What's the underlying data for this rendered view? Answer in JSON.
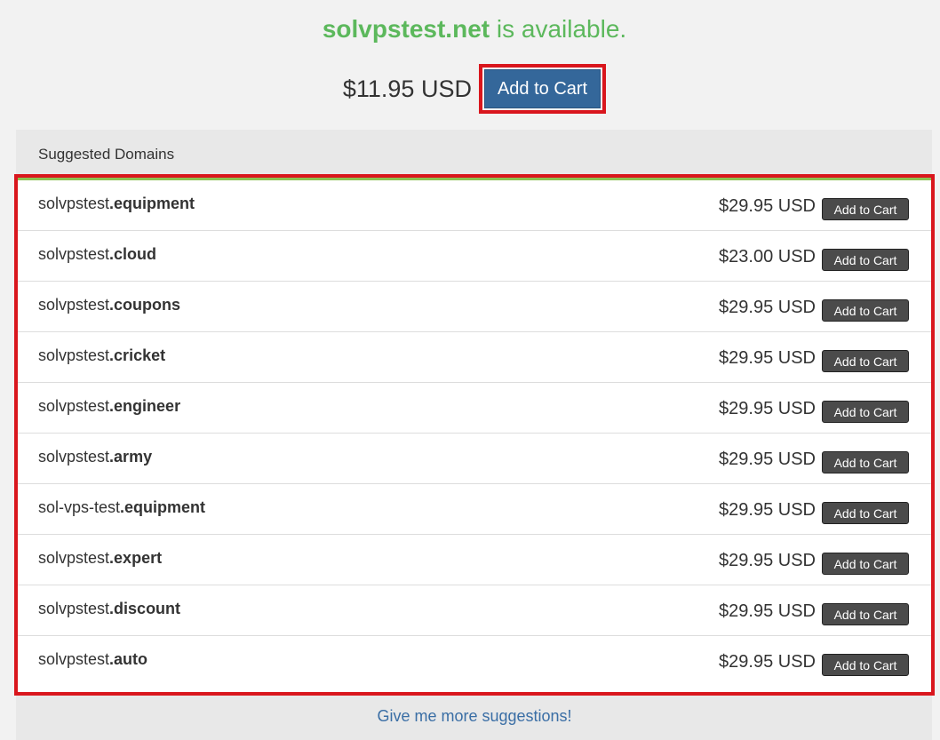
{
  "availability": {
    "domain": "solvpstest.net",
    "message": " is available."
  },
  "main_offer": {
    "price": "$11.95 USD",
    "button_label": "Add to Cart"
  },
  "suggestions": {
    "header": "Suggested Domains",
    "items": [
      {
        "base": "solvpstest",
        "tld": ".equipment",
        "price": "$29.95 USD",
        "button_label": "Add to Cart"
      },
      {
        "base": "solvpstest",
        "tld": ".cloud",
        "price": "$23.00 USD",
        "button_label": "Add to Cart"
      },
      {
        "base": "solvpstest",
        "tld": ".coupons",
        "price": "$29.95 USD",
        "button_label": "Add to Cart"
      },
      {
        "base": "solvpstest",
        "tld": ".cricket",
        "price": "$29.95 USD",
        "button_label": "Add to Cart"
      },
      {
        "base": "solvpstest",
        "tld": ".engineer",
        "price": "$29.95 USD",
        "button_label": "Add to Cart"
      },
      {
        "base": "solvpstest",
        "tld": ".army",
        "price": "$29.95 USD",
        "button_label": "Add to Cart"
      },
      {
        "base": "sol-vps-test",
        "tld": ".equipment",
        "price": "$29.95 USD",
        "button_label": "Add to Cart"
      },
      {
        "base": "solvpstest",
        "tld": ".expert",
        "price": "$29.95 USD",
        "button_label": "Add to Cart"
      },
      {
        "base": "solvpstest",
        "tld": ".discount",
        "price": "$29.95 USD",
        "button_label": "Add to Cart"
      },
      {
        "base": "solvpstest",
        "tld": ".auto",
        "price": "$29.95 USD",
        "button_label": "Add to Cart"
      }
    ],
    "more_link": "Give me more suggestions!"
  },
  "colors": {
    "available_green": "#5cb85c",
    "primary_button": "#34679a",
    "row_button": "#4b4b4b",
    "highlight_red": "#d9161d",
    "link_blue": "#3a6ea5"
  }
}
